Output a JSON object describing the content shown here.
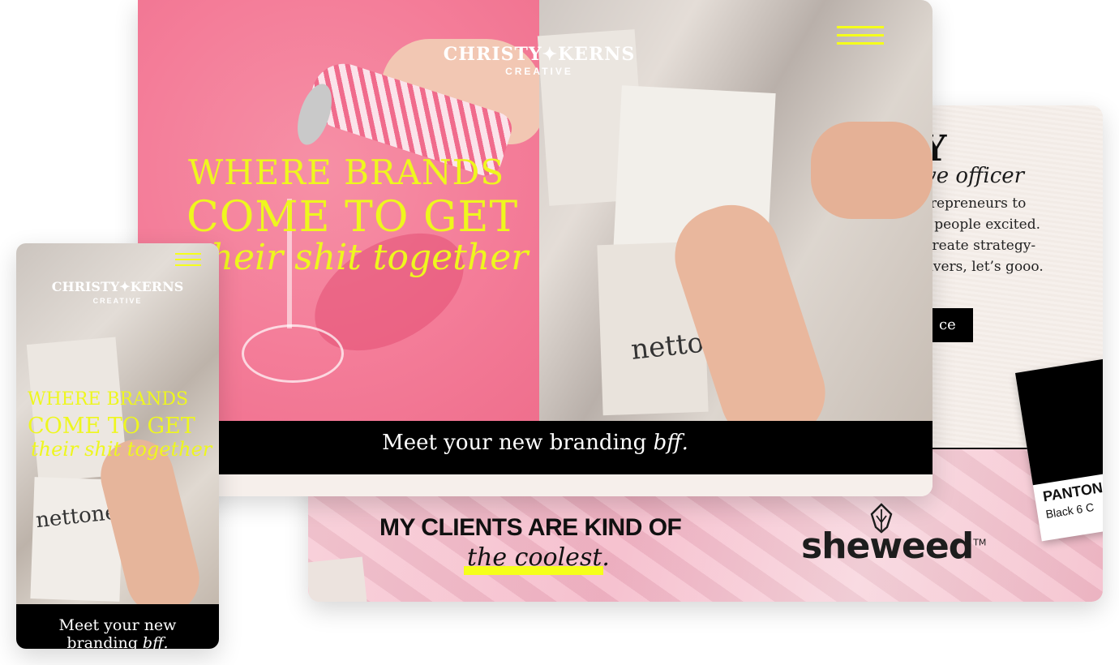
{
  "back_card": {
    "heading_fragment": "Y",
    "role_fragment": "ve officer",
    "paragraph_lines": [
      "trepreneurs to",
      "t people excited.",
      "create strategy-",
      "livers, let’s gooo."
    ],
    "cta_fragment": "ce",
    "clients_heading": "MY CLIENTS ARE KIND OF",
    "clients_subheading": "the coolest.",
    "client_logo": "sheweed",
    "client_logo_tm": "TM",
    "pantone_brand": "PANTON",
    "pantone_color": "Black 6 C"
  },
  "desktop_card": {
    "brand_name": "CHRISTY✦KERNS",
    "brand_sub": "CREATIVE",
    "hero_line1": "WHERE BRANDS",
    "hero_line2": "COME TO GET",
    "hero_line3": "their shit together",
    "tagline_main": "Meet your new branding ",
    "tagline_italic": "bff.",
    "photo_text": "nettone"
  },
  "mobile_card": {
    "brand_name": "CHRISTY✦KERNS",
    "brand_sub": "CREATIVE",
    "hero_line1": "WHERE BRANDS",
    "hero_line2": "COME TO GET",
    "hero_line3": "their shit together",
    "tagline_line1": "Meet your new",
    "tagline_line2": "branding ",
    "tagline_italic": "bff.",
    "photo_text": "nettone"
  },
  "colors": {
    "accent_yellow": "#eef71e",
    "hero_pink": "#f47d99",
    "black": "#000000"
  },
  "icons": [
    "hamburger-menu-icon",
    "sheweed-leaf-icon"
  ]
}
